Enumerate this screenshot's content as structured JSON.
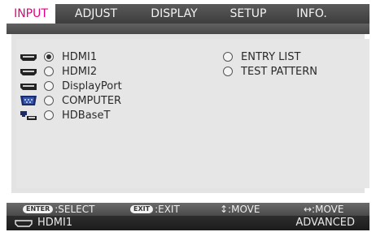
{
  "tabs": [
    {
      "label": "INPUT",
      "active": true
    },
    {
      "label": "ADJUST",
      "active": false
    },
    {
      "label": "DISPLAY",
      "active": false
    },
    {
      "label": "SETUP",
      "active": false
    },
    {
      "label": "INFO.",
      "active": false
    }
  ],
  "sources": [
    {
      "label": "HDMI1",
      "icon": "hdmi-icon",
      "selected": true
    },
    {
      "label": "HDMI2",
      "icon": "hdmi-icon",
      "selected": false
    },
    {
      "label": "DisplayPort",
      "icon": "displayport-icon",
      "selected": false
    },
    {
      "label": "COMPUTER",
      "icon": "vga-icon",
      "selected": false
    },
    {
      "label": "HDBaseT",
      "icon": "hdbaset-icon",
      "selected": false
    }
  ],
  "options": [
    {
      "label": "ENTRY LIST",
      "selected": false
    },
    {
      "label": "TEST PATTERN",
      "selected": false
    }
  ],
  "hints": {
    "enter_key": "ENTER",
    "enter_label": ":SELECT",
    "exit_key": "EXIT",
    "exit_label": ":EXIT",
    "move_vertical": "↕:MOVE",
    "move_horizontal": "↔:MOVE"
  },
  "status": {
    "current_input": "HDMI1",
    "mode": "ADVANCED"
  },
  "colors": {
    "accent": "#e3007f",
    "panel": "#e3e3e3"
  }
}
